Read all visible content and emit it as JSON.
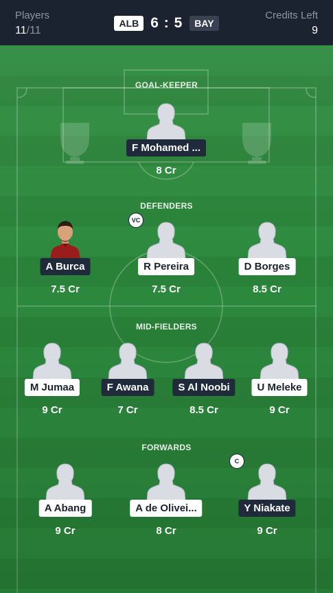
{
  "header": {
    "players_label": "Players",
    "players_selected": "11",
    "players_total": "/11",
    "credits_label": "Credits Left",
    "credits_value": "9",
    "home_team": "ALB",
    "away_team": "BAY",
    "score": "6 : 5"
  },
  "sections": {
    "goalkeeper": "GOAL-KEEPER",
    "defenders": "DEFENDERS",
    "midfielders": "MID-FIELDERS",
    "forwards": "FORWARDS"
  },
  "players": [
    {
      "name": "F Mohamed ...",
      "credits": "8 Cr",
      "team": "away",
      "photo": false,
      "badge": ""
    },
    {
      "name": "A Burca",
      "credits": "7.5 Cr",
      "team": "away",
      "photo": true,
      "badge": ""
    },
    {
      "name": "R Pereira",
      "credits": "7.5 Cr",
      "team": "home",
      "photo": false,
      "badge": "VC"
    },
    {
      "name": "D Borges",
      "credits": "8.5 Cr",
      "team": "home",
      "photo": false,
      "badge": ""
    },
    {
      "name": "M Jumaa",
      "credits": "9 Cr",
      "team": "home",
      "photo": false,
      "badge": ""
    },
    {
      "name": "F Awana",
      "credits": "7 Cr",
      "team": "away",
      "photo": false,
      "badge": ""
    },
    {
      "name": "S Al Noobi",
      "credits": "8.5 Cr",
      "team": "away",
      "photo": false,
      "badge": ""
    },
    {
      "name": "U Meleke",
      "credits": "9 Cr",
      "team": "home",
      "photo": false,
      "badge": ""
    },
    {
      "name": "A Abang",
      "credits": "9 Cr",
      "team": "home",
      "photo": false,
      "badge": ""
    },
    {
      "name": "A de Olivei...",
      "credits": "8 Cr",
      "team": "home",
      "photo": false,
      "badge": ""
    },
    {
      "name": "Y Niakate",
      "credits": "9 Cr",
      "team": "away",
      "photo": false,
      "badge": "C"
    }
  ],
  "colors": {
    "header_bg": "#1b2330",
    "pitch_green": "#2d8a3e",
    "home_tag": "#ffffff",
    "away_tag": "#1f2a3a"
  }
}
